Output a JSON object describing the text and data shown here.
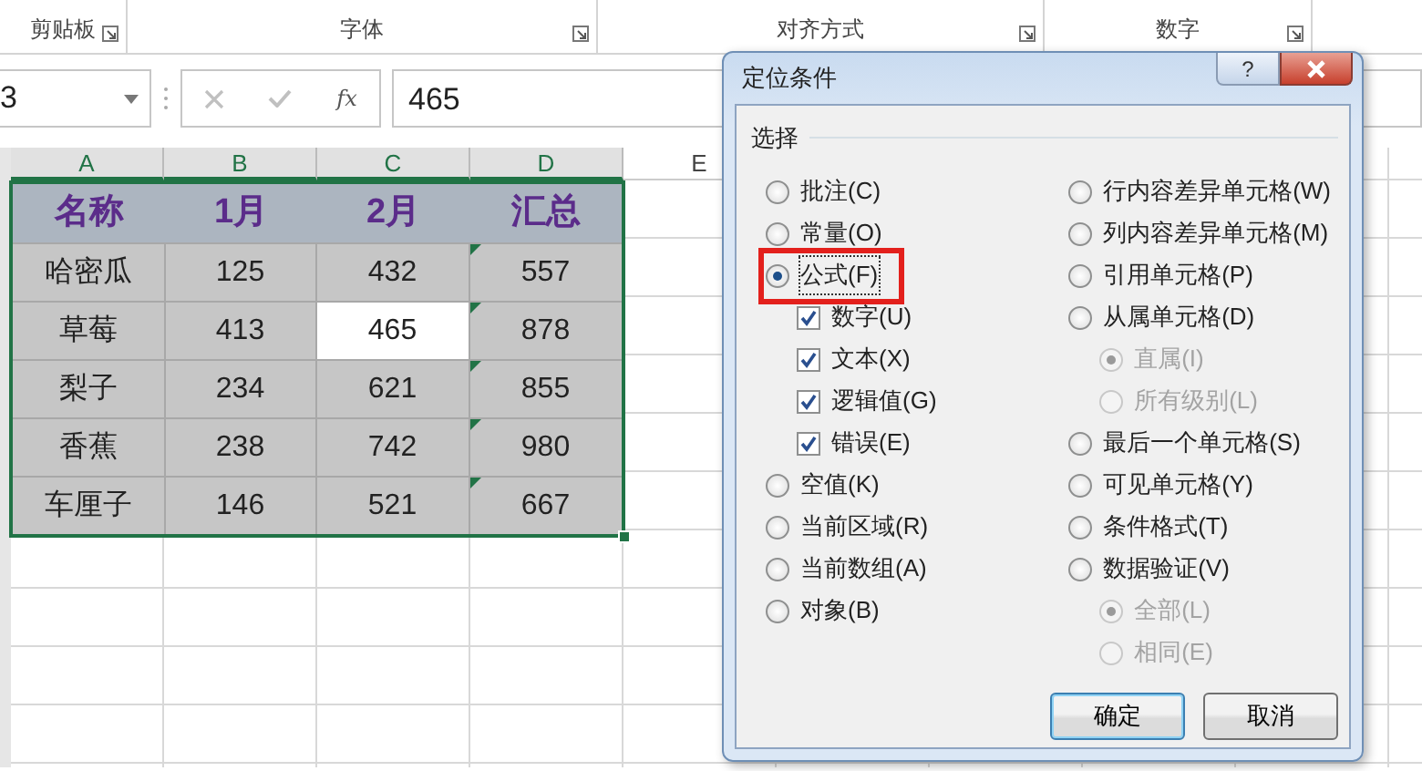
{
  "ribbon_groups": [
    {
      "label": "剪贴板"
    },
    {
      "label": "字体"
    },
    {
      "label": "对齐方式"
    },
    {
      "label": "数字"
    }
  ],
  "name_box": {
    "value": "3"
  },
  "formula_bar": {
    "function_label": "fx",
    "value": "465"
  },
  "column_headers": [
    {
      "label": "A",
      "selected": true
    },
    {
      "label": "B",
      "selected": true
    },
    {
      "label": "C",
      "selected": true
    },
    {
      "label": "D",
      "selected": true
    },
    {
      "label": "E",
      "selected": false
    }
  ],
  "table": {
    "columns": [
      "名称",
      "1月",
      "2月",
      "汇总"
    ],
    "rows": [
      {
        "cells": [
          {
            "text": "哈密瓜",
            "active": false,
            "flag": false
          },
          {
            "text": "125",
            "active": false,
            "flag": false
          },
          {
            "text": "432",
            "active": false,
            "flag": false
          },
          {
            "text": "557",
            "active": false,
            "flag": true
          }
        ]
      },
      {
        "cells": [
          {
            "text": "草莓",
            "active": false,
            "flag": false
          },
          {
            "text": "413",
            "active": false,
            "flag": false
          },
          {
            "text": "465",
            "active": true,
            "flag": false
          },
          {
            "text": "878",
            "active": false,
            "flag": true
          }
        ]
      },
      {
        "cells": [
          {
            "text": "梨子",
            "active": false,
            "flag": false
          },
          {
            "text": "234",
            "active": false,
            "flag": false
          },
          {
            "text": "621",
            "active": false,
            "flag": false
          },
          {
            "text": "855",
            "active": false,
            "flag": true
          }
        ]
      },
      {
        "cells": [
          {
            "text": "香蕉",
            "active": false,
            "flag": false
          },
          {
            "text": "238",
            "active": false,
            "flag": false
          },
          {
            "text": "742",
            "active": false,
            "flag": false
          },
          {
            "text": "980",
            "active": false,
            "flag": true
          }
        ]
      },
      {
        "cells": [
          {
            "text": "车厘子",
            "active": false,
            "flag": false
          },
          {
            "text": "146",
            "active": false,
            "flag": false
          },
          {
            "text": "521",
            "active": false,
            "flag": false
          },
          {
            "text": "667",
            "active": false,
            "flag": true
          }
        ]
      }
    ]
  },
  "dialog": {
    "title": "定位条件",
    "help": "?",
    "group_label": "选择",
    "left": [
      {
        "kind": "radio",
        "label": "批注(C)",
        "selected": false,
        "disabled": false
      },
      {
        "kind": "radio",
        "label": "常量(O)",
        "selected": false,
        "disabled": false
      },
      {
        "kind": "radio",
        "label": "公式(F)",
        "selected": true,
        "disabled": false,
        "highlighted": true,
        "children": [
          {
            "kind": "checkbox",
            "label": "数字(U)",
            "checked": true,
            "disabled": false
          },
          {
            "kind": "checkbox",
            "label": "文本(X)",
            "checked": true,
            "disabled": false
          },
          {
            "kind": "checkbox",
            "label": "逻辑值(G)",
            "checked": true,
            "disabled": false
          },
          {
            "kind": "checkbox",
            "label": "错误(E)",
            "checked": true,
            "disabled": false
          }
        ]
      },
      {
        "kind": "radio",
        "label": "空值(K)",
        "selected": false,
        "disabled": false
      },
      {
        "kind": "radio",
        "label": "当前区域(R)",
        "selected": false,
        "disabled": false
      },
      {
        "kind": "radio",
        "label": "当前数组(A)",
        "selected": false,
        "disabled": false
      },
      {
        "kind": "radio",
        "label": "对象(B)",
        "selected": false,
        "disabled": false
      }
    ],
    "right": [
      {
        "kind": "radio",
        "label": "行内容差异单元格(W)",
        "selected": false,
        "disabled": false
      },
      {
        "kind": "radio",
        "label": "列内容差异单元格(M)",
        "selected": false,
        "disabled": false
      },
      {
        "kind": "radio",
        "label": "引用单元格(P)",
        "selected": false,
        "disabled": false
      },
      {
        "kind": "radio",
        "label": "从属单元格(D)",
        "selected": false,
        "disabled": false,
        "children": [
          {
            "kind": "radio",
            "label": "直属(I)",
            "selected": true,
            "disabled": true
          },
          {
            "kind": "radio",
            "label": "所有级别(L)",
            "selected": false,
            "disabled": true
          }
        ]
      },
      {
        "kind": "radio",
        "label": "最后一个单元格(S)",
        "selected": false,
        "disabled": false
      },
      {
        "kind": "radio",
        "label": "可见单元格(Y)",
        "selected": false,
        "disabled": false
      },
      {
        "kind": "radio",
        "label": "条件格式(T)",
        "selected": false,
        "disabled": false
      },
      {
        "kind": "radio",
        "label": "数据验证(V)",
        "selected": false,
        "disabled": false,
        "children": [
          {
            "kind": "radio",
            "label": "全部(L)",
            "selected": true,
            "disabled": true
          },
          {
            "kind": "radio",
            "label": "相同(E)",
            "selected": false,
            "disabled": true
          }
        ]
      }
    ],
    "buttons": [
      {
        "label": "确定",
        "default": true
      },
      {
        "label": "取消",
        "default": false
      }
    ]
  }
}
